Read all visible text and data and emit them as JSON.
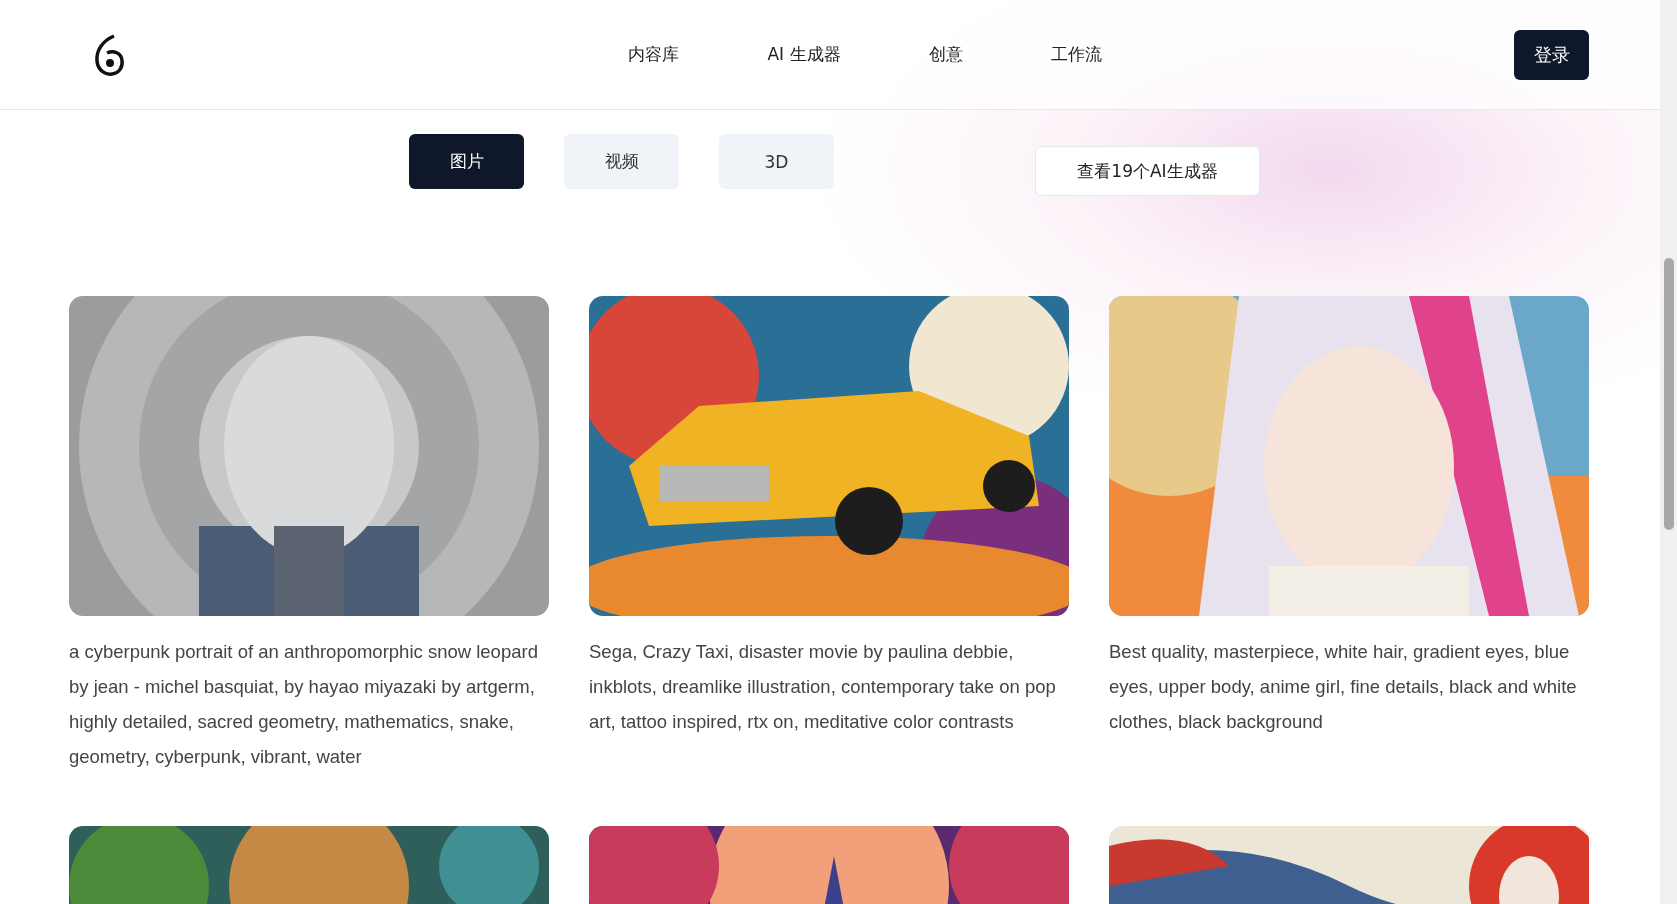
{
  "header": {
    "nav": [
      {
        "label": "内容库"
      },
      {
        "label": "AI 生成器"
      },
      {
        "label": "创意"
      },
      {
        "label": "工作流"
      }
    ],
    "login": "登录"
  },
  "media_tabs": [
    {
      "label": "图片",
      "selected": true
    },
    {
      "label": "视频",
      "selected": false
    },
    {
      "label": "3D",
      "selected": false
    }
  ],
  "generators_button": "查看19个AI生成器",
  "gallery": [
    {
      "kind": "picture",
      "prompt": "a cyberpunk portrait of an anthropomorphic snow leopard by jean - michel basquiat, by hayao miyazaki by artgerm, highly detailed, sacred geometry, mathematics, snake, geometry, cyberpunk, vibrant, water"
    },
    {
      "kind": "picture",
      "prompt": "Sega, Crazy Taxi, disaster movie by paulina debbie, inkblots, dreamlike illustration, contemporary take on pop art, tattoo inspired, rtx on, meditative color contrasts"
    },
    {
      "kind": "picture",
      "prompt": "Best quality, masterpiece, white hair, gradient eyes, blue eyes, upper body, anime girl, fine details, black and white clothes, black background"
    },
    {
      "kind": "picture"
    },
    {
      "kind": "picture"
    },
    {
      "kind": "picture"
    }
  ]
}
